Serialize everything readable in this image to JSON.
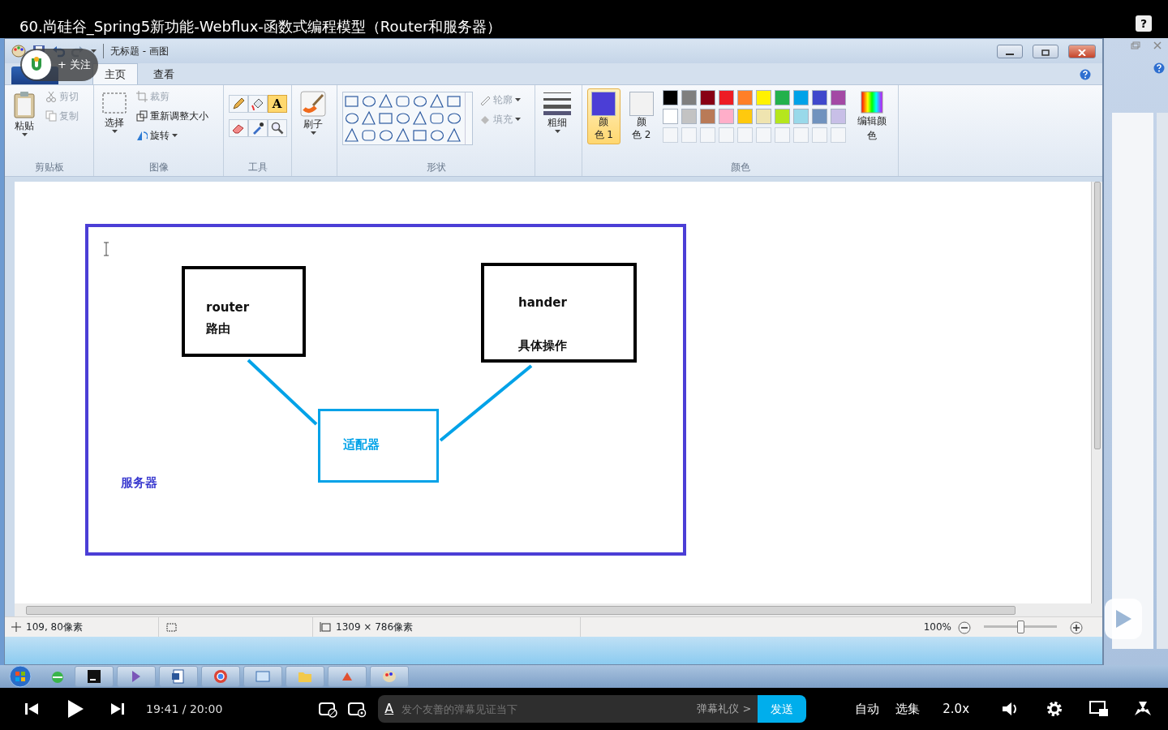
{
  "video": {
    "title": "60.尚硅谷_Spring5新功能-Webflux-函数式编程模型（Router和服务器）",
    "help": "?"
  },
  "uploader": {
    "follow": "+ 关注"
  },
  "paint": {
    "title": "无标题 - 画图",
    "tabs": [
      {
        "label": "主页",
        "selected": true
      },
      {
        "label": "查看",
        "selected": false
      }
    ],
    "clipboard": {
      "paste": "粘贴",
      "cut": "剪切",
      "copy": "复制",
      "group": "剪贴板"
    },
    "image": {
      "select": "选择",
      "crop": "裁剪",
      "resize": "重新调整大小",
      "rotate": "旋转",
      "group": "图像"
    },
    "tools": {
      "group": "工具",
      "items": [
        {
          "kind": "pencil",
          "selected": false
        },
        {
          "kind": "fill",
          "selected": false
        },
        {
          "kind": "text",
          "label": "A",
          "selected": true
        },
        {
          "kind": "eraser",
          "selected": false
        },
        {
          "kind": "picker",
          "selected": false
        },
        {
          "kind": "magnifier",
          "selected": false
        }
      ]
    },
    "brushes": "刷子",
    "shapes": {
      "outline": "轮廓",
      "fill": "填充",
      "group": "形状"
    },
    "size": "粗细",
    "colors": {
      "group": "颜色",
      "edit": "编辑颜色",
      "slots": [
        {
          "lines": [
            "颜",
            "色 1"
          ],
          "color": "#4b3ed6",
          "selected": true
        },
        {
          "lines": [
            "颜",
            "色 2"
          ],
          "color": "#f2f2f2",
          "selected": false
        }
      ],
      "palette": [
        {
          "color": "#000000"
        },
        {
          "color": "#7f7f7f"
        },
        {
          "color": "#880015"
        },
        {
          "color": "#ed1c24"
        },
        {
          "color": "#ff7f27"
        },
        {
          "color": "#fff200"
        },
        {
          "color": "#22b14c"
        },
        {
          "color": "#00a2e8"
        },
        {
          "color": "#3f48cc"
        },
        {
          "color": "#a349a4"
        },
        {
          "color": "#ffffff"
        },
        {
          "color": "#c3c3c3"
        },
        {
          "color": "#b97a57"
        },
        {
          "color": "#ffaec9"
        },
        {
          "color": "#ffc90e"
        },
        {
          "color": "#efe4b0"
        },
        {
          "color": "#b5e61d"
        },
        {
          "color": "#99d9ea"
        },
        {
          "color": "#7092be"
        },
        {
          "color": "#c8bfe7"
        }
      ]
    },
    "diagram": {
      "boxes": [
        {
          "kind": "black",
          "lines": [
            "router",
            "路由"
          ]
        },
        {
          "kind": "black",
          "lines": [
            "hander",
            "具体操作"
          ]
        },
        {
          "kind": "blue",
          "lines": [
            "适配器"
          ]
        }
      ],
      "label": "服务器"
    },
    "status": {
      "position": "109, 80像素",
      "size": "1309 × 786像素",
      "zoom": "100%",
      "zoom_slider": {
        "level": 0.5
      }
    }
  },
  "controls": {
    "time": "19:41 / 20:00",
    "danmaku_style": "A",
    "placeholder": "发个友善的弹幕见证当下",
    "etiquette": "弹幕礼仪 >",
    "send": "发送",
    "quality": "自动",
    "episodes": "选集",
    "speed": "2.0x"
  }
}
